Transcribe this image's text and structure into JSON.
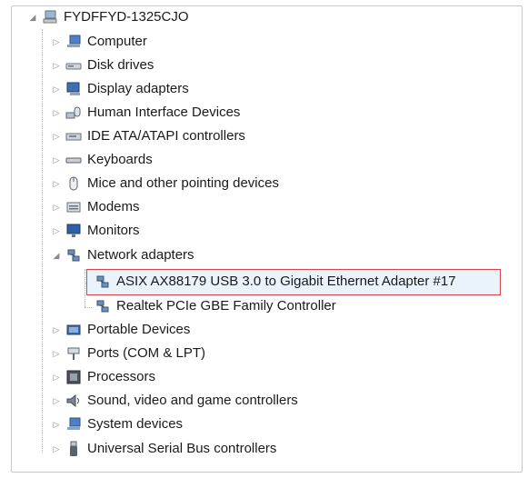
{
  "root": {
    "label": "FYDFFYD-1325CJO",
    "icon": "computer-root-icon"
  },
  "categories": [
    {
      "label": "Computer",
      "icon": "computer-icon",
      "expanded": false
    },
    {
      "label": "Disk drives",
      "icon": "disk-drive-icon",
      "expanded": false
    },
    {
      "label": "Display adapters",
      "icon": "display-adapter-icon",
      "expanded": false
    },
    {
      "label": "Human Interface Devices",
      "icon": "hid-icon",
      "expanded": false
    },
    {
      "label": "IDE ATA/ATAPI controllers",
      "icon": "ide-controller-icon",
      "expanded": false
    },
    {
      "label": "Keyboards",
      "icon": "keyboard-icon",
      "expanded": false
    },
    {
      "label": "Mice and other pointing devices",
      "icon": "mouse-icon",
      "expanded": false
    },
    {
      "label": "Modems",
      "icon": "modem-icon",
      "expanded": false
    },
    {
      "label": "Monitors",
      "icon": "monitor-icon",
      "expanded": false
    },
    {
      "label": "Network adapters",
      "icon": "network-adapter-icon",
      "expanded": true,
      "children": [
        {
          "label": "ASIX AX88179 USB 3.0 to Gigabit Ethernet Adapter #17",
          "icon": "network-adapter-icon",
          "selected": true
        },
        {
          "label": "Realtek PCIe GBE Family Controller",
          "icon": "network-adapter-icon",
          "selected": false
        }
      ]
    },
    {
      "label": "Portable Devices",
      "icon": "portable-device-icon",
      "expanded": false
    },
    {
      "label": "Ports (COM & LPT)",
      "icon": "port-icon",
      "expanded": false
    },
    {
      "label": "Processors",
      "icon": "processor-icon",
      "expanded": false
    },
    {
      "label": "Sound, video and game controllers",
      "icon": "sound-icon",
      "expanded": false
    },
    {
      "label": "System devices",
      "icon": "system-device-icon",
      "expanded": false
    },
    {
      "label": "Universal Serial Bus controllers",
      "icon": "usb-icon",
      "expanded": false
    }
  ],
  "colors": {
    "highlight_border": "#d9434a",
    "selection_fill": "#eaf3fb"
  }
}
